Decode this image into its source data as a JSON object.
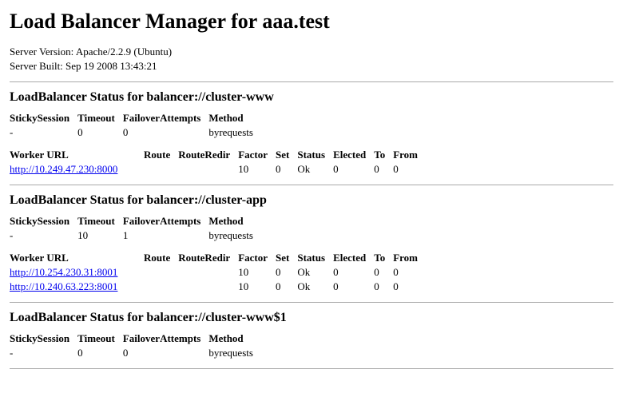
{
  "title": "Load Balancer Manager for aaa.test",
  "server_version_label": "Server Version:",
  "server_version_value": "Apache/2.2.9 (Ubuntu)",
  "server_built_label": "Server Built:",
  "server_built_value": "Sep 19 2008 13:43:21",
  "status_prefix": "LoadBalancer Status for",
  "config_headers": {
    "sticky": "StickySession",
    "timeout": "Timeout",
    "failover": "FailoverAttempts",
    "method": "Method"
  },
  "worker_headers": {
    "url": "Worker URL",
    "route": "Route",
    "redir": "RouteRedir",
    "factor": "Factor",
    "set": "Set",
    "status": "Status",
    "elected": "Elected",
    "to": "To",
    "from": "From"
  },
  "balancers": [
    {
      "name": "balancer://cluster-www",
      "config": {
        "sticky": "-",
        "timeout": "0",
        "failover": "0",
        "method": "byrequests"
      },
      "workers": [
        {
          "url": "http://10.249.47.230:8000",
          "route": "",
          "redir": "",
          "factor": "10",
          "set": "0",
          "status": "Ok",
          "elected": "0",
          "to": "0",
          "from": "0"
        }
      ]
    },
    {
      "name": "balancer://cluster-app",
      "config": {
        "sticky": "-",
        "timeout": "10",
        "failover": "1",
        "method": "byrequests"
      },
      "workers": [
        {
          "url": "http://10.254.230.31:8001",
          "route": "",
          "redir": "",
          "factor": "10",
          "set": "0",
          "status": "Ok",
          "elected": "0",
          "to": "0",
          "from": "0"
        },
        {
          "url": "http://10.240.63.223:8001",
          "route": "",
          "redir": "",
          "factor": "10",
          "set": "0",
          "status": "Ok",
          "elected": "0",
          "to": "0",
          "from": "0"
        }
      ]
    },
    {
      "name": "balancer://cluster-www$1",
      "config": {
        "sticky": "-",
        "timeout": "0",
        "failover": "0",
        "method": "byrequests"
      },
      "workers": []
    }
  ]
}
